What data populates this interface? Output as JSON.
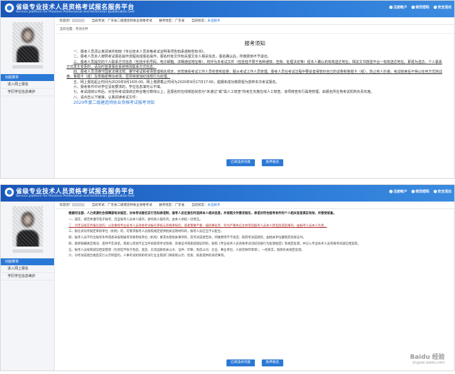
{
  "app": {
    "title_cn": "省级专业技术人员资格考试报名服务平台",
    "title_en": "Service platform for Province Professional and technician qualification test",
    "actions": [
      "注册帐户",
      "修改密码",
      "安全退出"
    ]
  },
  "sidebar": {
    "menu_head": "功能菜单",
    "items": [
      "进入网上报名",
      "学历学位信息维护"
    ]
  },
  "userbar": {
    "welcome": "欢迎您！",
    "exam_label": "当前考试：",
    "exam_value": "广东省二级建造师执业资格考试",
    "area_label": "报考地区：",
    "area_value": "广东省",
    "current_status": "当前状态：",
    "status_value": "未选报考"
  },
  "crumb": "当前位置：考试文件",
  "notice1": {
    "title": "报考须知",
    "paras": [
      "一、报考人员须认真阅读并知晓《专业技术人员资格考试证明事项告知承诺制告知书》。",
      "二、报考人员本人按照考试报名操作流程完成报名操作，报名时有文件知关报文本人相关信息，报名确认后，所缴费用不予退还。",
      "三、报考人员提交的个人联系方式信息（包括手机号码、电子邮箱、详细通信地址等），将作为本考试文件（包括但不限于各种通知、告知、处理决定等）经本人确认的有效送达地址，相关文书按送平台一有效送达地址，即视为送达。个人联系方式发生变更的，请及时登录报名系统修改联系方式信息。",
      "四、报考人员须遵守国家法律法规，遵守考试和考场管理相关规定，自觉接受考试工作人员检查和监督，服从考试工作人员管理。报考人员在考试过程中要妥善保管好自己的试卷和答题卡（纸），防止他人抄袭，考试结束后不得以任何方式将试卷、答题卡（纸）及草稿纸带出考场，否则将按违纪违规行为处理。",
      "五、网上报名起止时间为2020年9月16日-00，网上缴费截止时间为2020年9月17日17:00，逾期未成功缴费视为放弃本次考试报名。",
      "六、报考条件中对学位没有要求的，学位信息填可以不填。",
      "七、考试成绩公布后，对全科考试成绩达到合格分数线以上，且报名时在线核验状态为\"未通过\"或\"需人工核查\"的考生实施在线人工核查。该项核查实行属地管理，由报名所在地考试机构负责实施。",
      "八、请点击以下链接，认真阅读考试文件："
    ],
    "link": "2020年度二级建造师执业资格考试报考须知",
    "buttons": [
      "已阅读并同意",
      "放弃报名"
    ]
  },
  "notice2": {
    "paras": [
      "根据司法部、人力资源社会保障部有关规定，对本考试报名实行告知承诺制，报考人员在报名时选择本人相关信息，并按照文件要求报名，承诺对符合报考条件的个人相关信息真实有效，并接受核查。",
      "一、诚实、规范并遵守电子报考，且自报考人员本人操作，委托他人操作的，由本人承担一切责任。",
      "二、对无法核实所报信息的，以及要经专业技术人员资格考试报名审核与资格审核的，或者需要严重、被刑事处罚、列为严重失信主体等因报考人员本人原因造成后果的，由报考人员本人负责。",
      "三、报名具有所规定审核单位（机构）的，可要求报考人员按照规定提供相关证明材料的，报考人员应当予以配合。",
      "四、报考人员不符合报考条件或者未按照报考资格审核单位（机构）要求办理相关事项的，其考试成绩无效，所缴费用不予退还；取得考试成绩的，由相关单位撤销其资格证书。",
      "四、能够隐瞒真实情况、提供不实承诺，或者以其他不正当手段取得考试资格、资格证书或者成绩证明的，按照《专业技术人员资格考试违纪违规行为处理规定》等规定处理，并记入专业技术人员资格考试诚信档案库。",
      "五、报考人员按照诚信档案管理（包括但不限于伪造、变造、买卖国家机关公文、证件、印章，伪造公司、企业、事业单位、人民团体印章等），一经查实，按照有关规定处理。",
      "六、对考试成绩合格后实行公示制度的，人事考试机构和考试行业主管部门将按照公示、检查、核查提供的承诺事项。"
    ],
    "buttons": [
      "已阅读并同意",
      "放弃报名"
    ]
  },
  "watermark": {
    "main": "Baidu 经验",
    "sub": "jingyan.baidu.com"
  },
  "colors": {
    "brand": "#2b79d6",
    "link": "#2b79d6"
  }
}
